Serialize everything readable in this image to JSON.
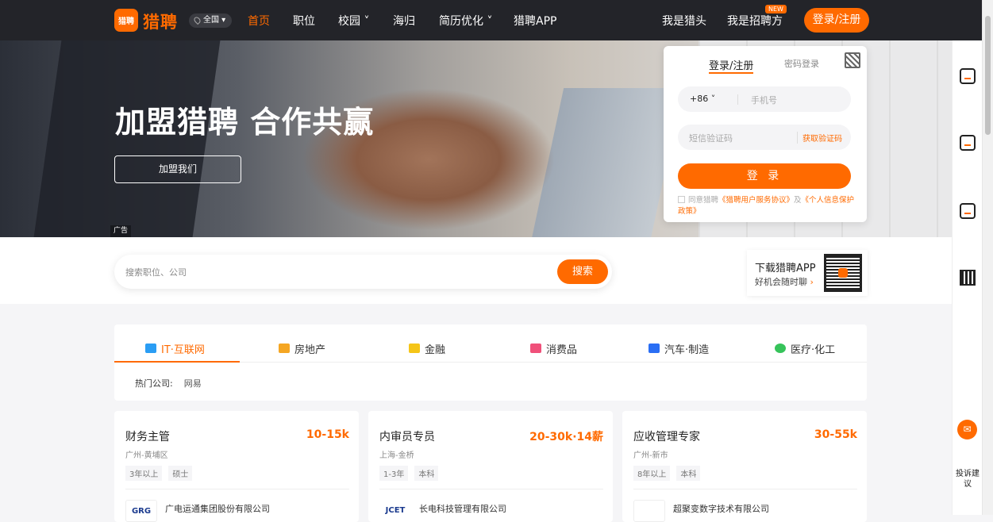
{
  "header": {
    "logo_mark": "猎聘",
    "logo_text": "猎聘",
    "city": "全国",
    "nav": [
      {
        "label": "首页",
        "active": true
      },
      {
        "label": "职位"
      },
      {
        "label": "校园 ˅"
      },
      {
        "label": "海归"
      },
      {
        "label": "简历优化 ˅"
      },
      {
        "label": "猎聘APP"
      }
    ],
    "headhunter": "我是猎头",
    "recruiter": "我是招聘方",
    "new_badge": "NEW",
    "login": "登录/注册"
  },
  "hero": {
    "title": "加盟猎聘 合作共赢",
    "join_button": "加盟我们",
    "ad_label": "广告"
  },
  "login_panel": {
    "tab_sms": "登录/注册",
    "tab_password": "密码登录",
    "country_code": "+86",
    "phone_placeholder": "手机号",
    "code_placeholder": "短信验证码",
    "get_code": "获取验证码",
    "submit": "登 录",
    "agree_prefix": "同意猎聘",
    "agree_link1": "《猎聘用户服务协议》",
    "agree_and": "及",
    "agree_link2": "《个人信息保护政策》"
  },
  "search": {
    "placeholder": "搜索职位、公司",
    "button": "搜索"
  },
  "app_download": {
    "title": "下载猎聘APP",
    "subtitle": "好机会随时聊",
    "arrow": "›"
  },
  "industries": {
    "tabs": [
      {
        "label": "IT·互联网",
        "icon": "monitor-icon",
        "color": "#2a9df4",
        "active": true
      },
      {
        "label": "房地产",
        "icon": "house-icon",
        "color": "#f5a623"
      },
      {
        "label": "金融",
        "icon": "coin-icon",
        "color": "#f5c518"
      },
      {
        "label": "消费品",
        "icon": "bag-icon",
        "color": "#f0507a"
      },
      {
        "label": "汽车·制造",
        "icon": "wrench-icon",
        "color": "#2a6ef4"
      },
      {
        "label": "医疗·化工",
        "icon": "flask-icon",
        "color": "#36c35a"
      }
    ],
    "hot_label": "热门公司:",
    "hot_company": "网易"
  },
  "jobs": [
    {
      "title": "财务主管",
      "salary": "10-15k",
      "location": "广州-黄埔区",
      "tags": [
        "3年以上",
        "硕士"
      ],
      "company": "广电运通集团股份有限公司",
      "logo_text": "GRG"
    },
    {
      "title": "内审员专员",
      "salary": "20-30k·14薪",
      "location": "上海-金桥",
      "tags": [
        "1-3年",
        "本科"
      ],
      "company": "长电科技管理有限公司",
      "logo_text": "JCET"
    },
    {
      "title": "应收管理专家",
      "salary": "30-55k",
      "location": "广州-新市",
      "tags": [
        "8年以上",
        "本科"
      ],
      "company": "超聚变数字技术有限公司",
      "logo_text": ""
    }
  ],
  "sidebar": {
    "chat_icon": "chat-icon",
    "feedback": "投诉建议"
  },
  "colors": {
    "accent": "#ff6a00",
    "nav_bg": "#232429"
  }
}
